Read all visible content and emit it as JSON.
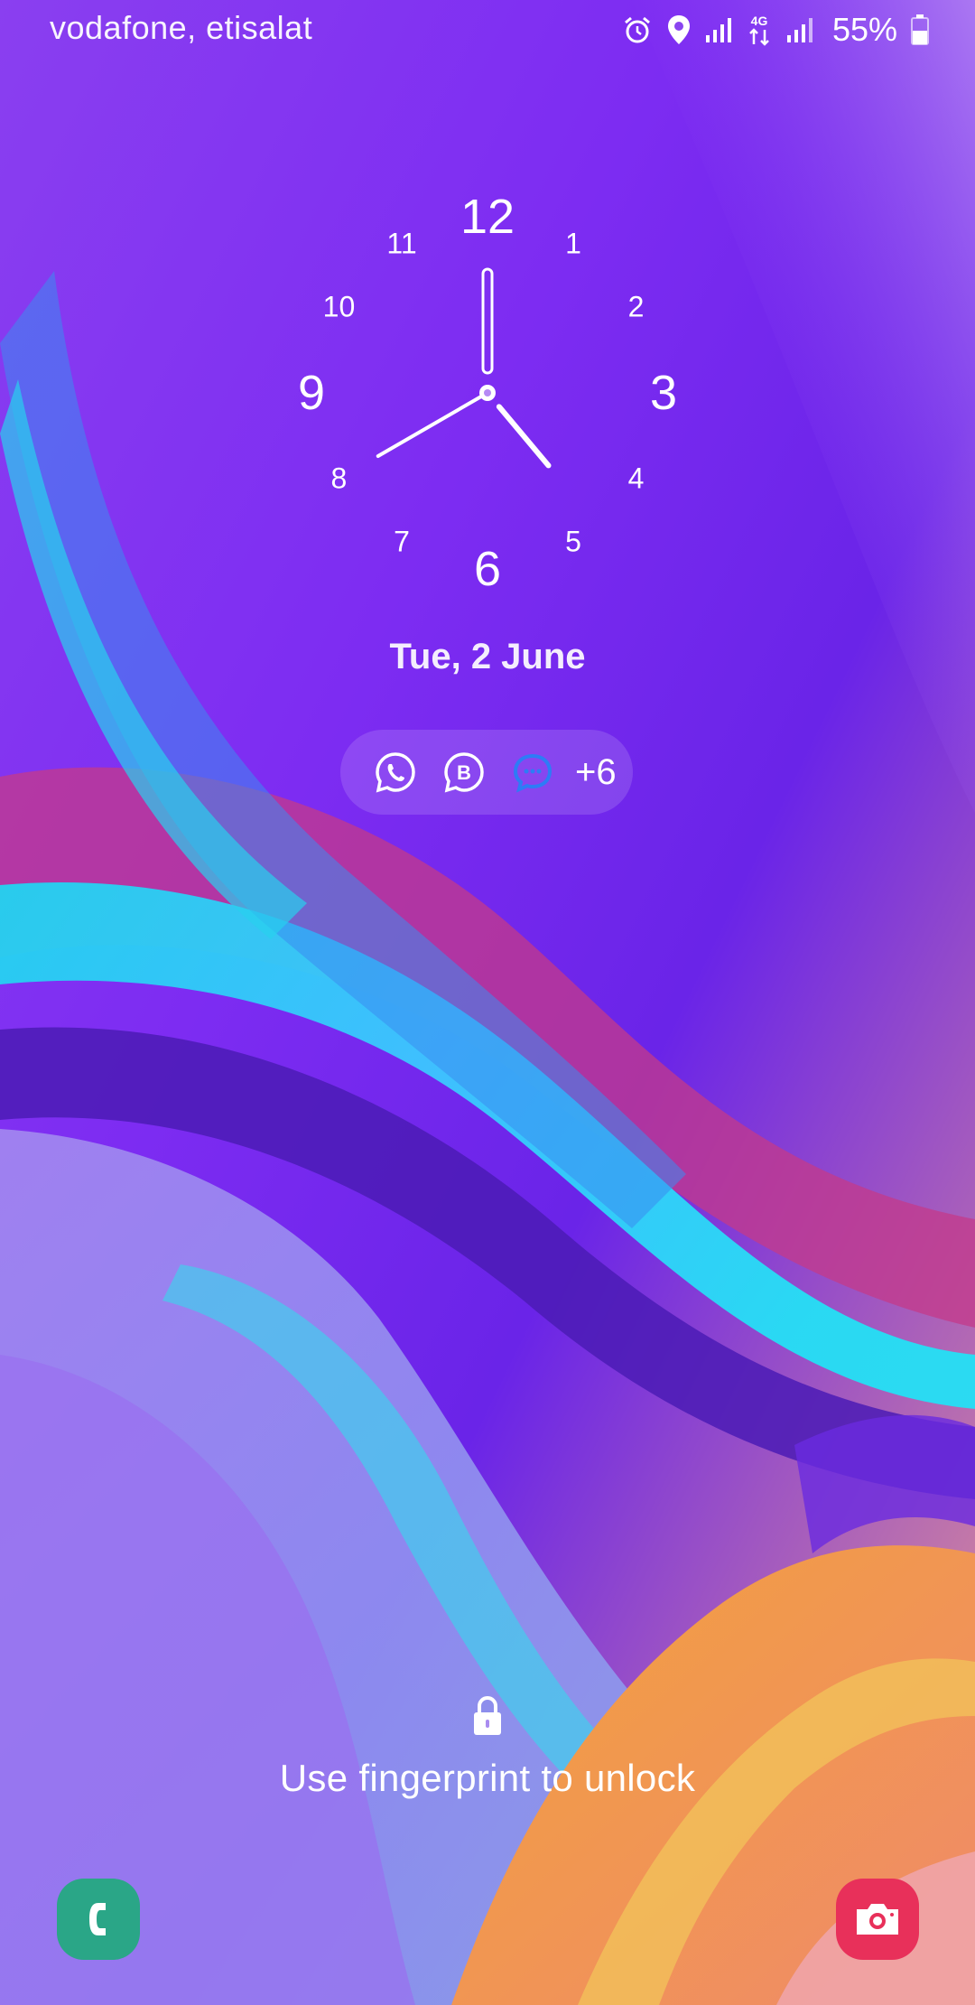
{
  "status_bar": {
    "carrier": "vodafone, etisalat",
    "network_type": "4G",
    "battery_percent": "55%",
    "battery_level": 0.55,
    "icons": [
      "alarm-icon",
      "location-icon",
      "signal-icon",
      "data-4g-icon",
      "signal-icon",
      "battery-icon"
    ]
  },
  "clock": {
    "numbers": [
      "12",
      "1",
      "2",
      "3",
      "4",
      "5",
      "6",
      "7",
      "8",
      "9",
      "10",
      "11"
    ],
    "time": {
      "hour": 4,
      "minute": 40
    }
  },
  "date": "Tue, 2 June",
  "notifications": {
    "apps": [
      "whatsapp-icon",
      "whatsapp-business-icon",
      "messages-icon"
    ],
    "more_count": "+6"
  },
  "unlock_hint": "Use fingerprint to unlock",
  "shortcuts": {
    "left": "phone-icon",
    "right": "camera-icon"
  },
  "colors": {
    "phone_shortcut": "#2aa687",
    "camera_shortcut": "#e8305a",
    "wallpaper_base": "#7a2cf0"
  }
}
